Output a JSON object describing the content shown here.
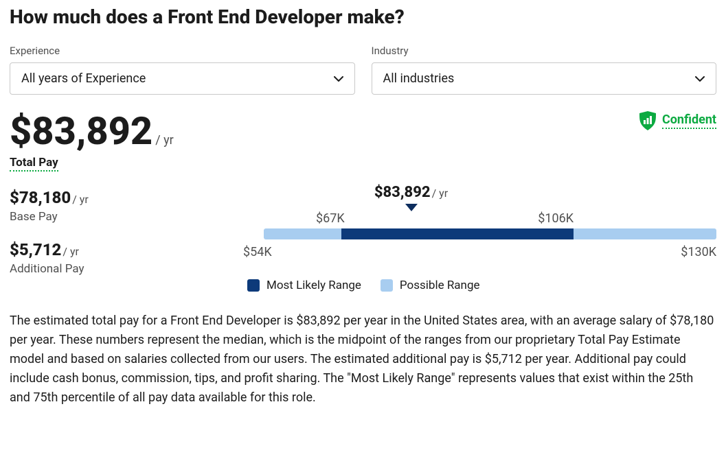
{
  "title": "How much does a Front End Developer make?",
  "filters": {
    "experience": {
      "label": "Experience",
      "value": "All years of Experience"
    },
    "industry": {
      "label": "Industry",
      "value": "All industries"
    }
  },
  "pay": {
    "total": {
      "amount": "$83,892",
      "suffix": "/ yr",
      "label": "Total Pay"
    },
    "base": {
      "amount": "$78,180",
      "suffix": "/ yr",
      "label": "Base Pay"
    },
    "additional": {
      "amount": "$5,712",
      "suffix": "/ yr",
      "label": "Additional Pay"
    }
  },
  "confidence": "Confident",
  "chart_data": {
    "type": "bar",
    "possible_range": {
      "min_label": "$54K",
      "max_label": "$130K",
      "min": 54,
      "max": 130
    },
    "likely_range": {
      "min_label": "$67K",
      "max_label": "$106K",
      "min": 67,
      "max": 106
    },
    "marker": {
      "amount": "$83,892",
      "suffix": "/ yr",
      "value": 83.892
    },
    "legend": {
      "likely": "Most Likely Range",
      "possible": "Possible Range"
    }
  },
  "description": "The estimated total pay for a Front End Developer is $83,892 per year in the United States area, with an average salary of $78,180 per year. These numbers represent the median, which is the midpoint of the ranges from our proprietary Total Pay Estimate model and based on salaries collected from our users. The estimated additional pay is $5,712 per year. Additional pay could include cash bonus, commission, tips, and profit sharing. The \"Most Likely Range\" represents values that exist within the 25th and 75th percentile of all pay data available for this role."
}
